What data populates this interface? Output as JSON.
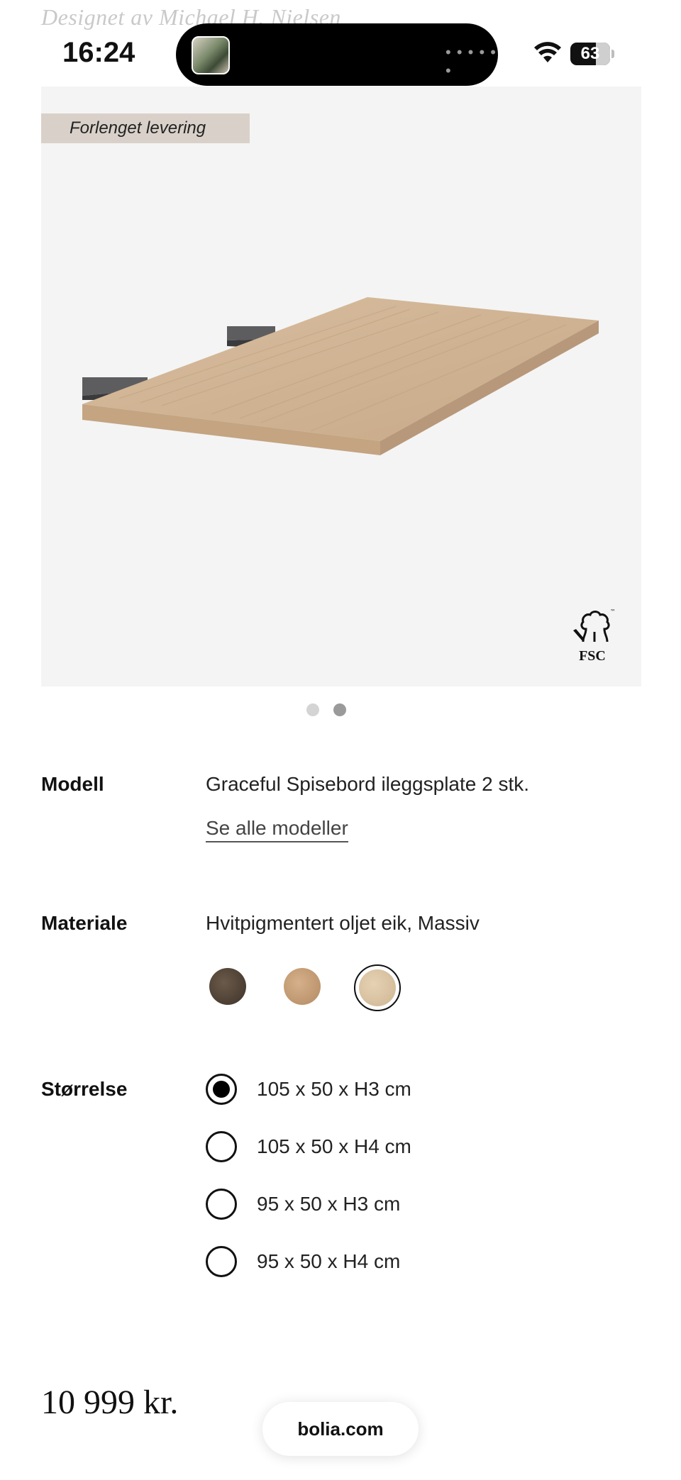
{
  "header": {
    "designer_text": "Designet av Michael H. Nielsen"
  },
  "status_bar": {
    "time": "16:24",
    "battery": "63"
  },
  "gallery": {
    "badge": "Forlenget levering",
    "certification": "FSC",
    "page_count": 2,
    "active_index": 1
  },
  "model": {
    "label": "Modell",
    "value": "Graceful Spisebord ileggsplate 2 stk.",
    "link": "Se alle modeller"
  },
  "material": {
    "label": "Materiale",
    "value": "Hvitpigmentert oljet eik, Massiv",
    "swatches": [
      {
        "name": "dark-oak",
        "color": "#4b3d31",
        "selected": false
      },
      {
        "name": "oiled-oak",
        "color": "#c49c74",
        "selected": false
      },
      {
        "name": "white-pigmented-oak",
        "color": "#dcc6a5",
        "selected": true
      }
    ]
  },
  "size": {
    "label": "Størrelse",
    "options": [
      {
        "label": "105 x 50 x H3 cm",
        "selected": true
      },
      {
        "label": "105 x 50 x H4 cm",
        "selected": false
      },
      {
        "label": "95 x 50 x H3 cm",
        "selected": false
      },
      {
        "label": "95 x 50 x H4 cm",
        "selected": false
      }
    ]
  },
  "price": "10 999 kr.",
  "browser": {
    "url": "bolia.com"
  }
}
